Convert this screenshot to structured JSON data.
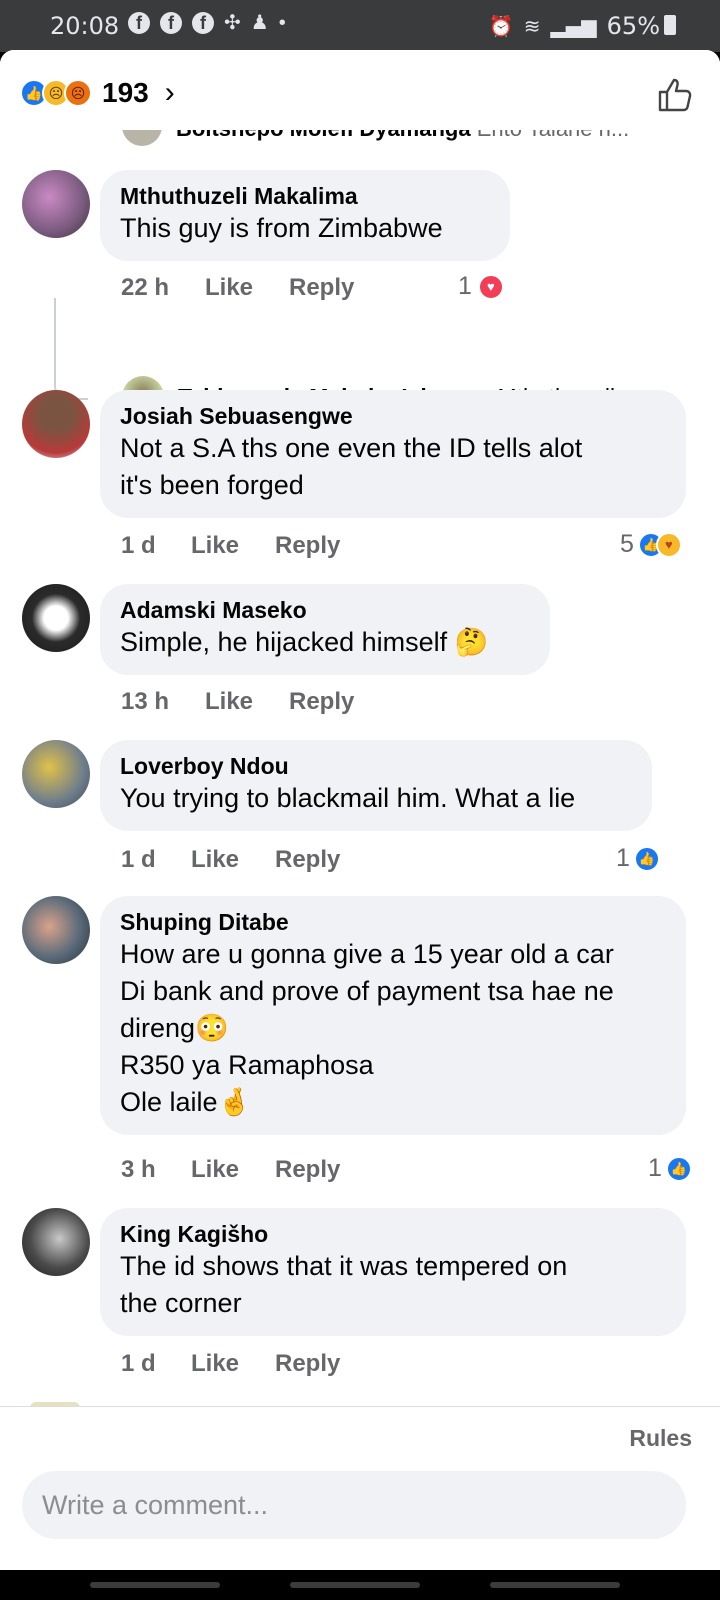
{
  "status_bar": {
    "time": "20:08",
    "app_icons": [
      "facebook-icon",
      "facebook-icon",
      "facebook-icon",
      "pinwheel-icon",
      "bell-person-icon"
    ],
    "dot": "•",
    "battery": "65%"
  },
  "header": {
    "reactions": [
      "like",
      "sad",
      "angry"
    ],
    "reaction_count": "193",
    "chevron": "›"
  },
  "partial_comment": {
    "author": "Boitshepo Molefi Dyamanga",
    "message": "Ento Talane n..."
  },
  "comments": [
    {
      "author": "Mthuthuzeli Makalima",
      "text": "This guy is from Zimbabwe",
      "time": "22 h",
      "like": "Like",
      "reply": "Reply",
      "reaction_count": "1",
      "reaction": "heart"
    },
    {
      "author": "Josiah Sebuasengwe",
      "text": "Not a S.A ths one even the ID tells alot\nit's been forged",
      "time": "1 d",
      "like": "Like",
      "reply": "Reply",
      "reaction_count": "5",
      "reaction": "like-care"
    },
    {
      "author": "Adamski Maseko",
      "text": "Simple, he hijacked himself 🤔",
      "time": "13 h",
      "like": "Like",
      "reply": "Reply"
    },
    {
      "author": "Loverboy Ndou",
      "text": "You trying to blackmail him. What a lie",
      "time": "1 d",
      "like": "Like",
      "reply": "Reply",
      "reaction_count": "1",
      "reaction": "like"
    },
    {
      "author": "Shuping Ditabe",
      "text": "How are u gonna give a 15 year old a car\nDi bank and prove of payment tsa hae ne\ndireng😳\nR350 ya Ramaphosa\nOle laile🤞",
      "time": "3 h",
      "like": "Like",
      "reply": "Reply",
      "reaction_count": "1",
      "reaction": "like"
    },
    {
      "author": "King Kagišho",
      "text": "The id shows that it was tempered on\nthe corner",
      "time": "1 d",
      "like": "Like",
      "reply": "Reply"
    }
  ],
  "reply_preview": {
    "author": "Tshigavade Makuku Ishmarc",
    "message": "Mthuthuzeli..."
  },
  "footer": {
    "rules": "Rules",
    "placeholder": "Write a comment..."
  },
  "colors": {
    "accent": "#1877f2",
    "bubble": "#f0f2f5",
    "secondary_text": "#65676b"
  }
}
